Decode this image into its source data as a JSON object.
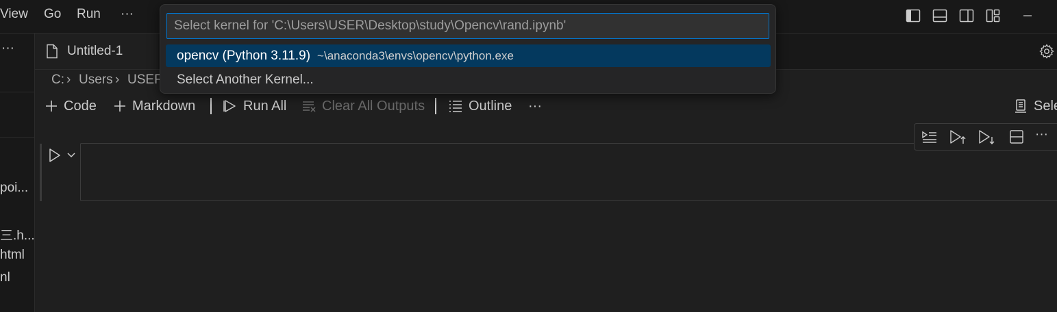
{
  "menu": [
    "View",
    "Go",
    "Run",
    "···"
  ],
  "tab": {
    "label": "Untitled-1"
  },
  "breadcrumb": [
    "C:",
    "Users",
    "USER"
  ],
  "sidebar": {
    "texts": [
      "poi...",
      "三.h...",
      "html",
      "nl"
    ]
  },
  "toolbar": {
    "code": "Code",
    "markdown": "Markdown",
    "run_all": "Run All",
    "clear_all": "Clear All Outputs",
    "outline": "Outline",
    "more": "···",
    "kernel": "Sele"
  },
  "quickpick": {
    "placeholder": "Select kernel for 'C:\\Users\\USER\\Desktop\\study\\Opencv\\rand.ipynb'",
    "items": [
      {
        "label": "opencv (Python 3.11.9)",
        "detail": "~\\anaconda3\\envs\\opencv\\python.exe"
      },
      {
        "label": "Select Another Kernel..."
      }
    ]
  },
  "colors": {
    "accent": "#0078d4",
    "selected_bg": "#04395e",
    "background": "#1f1f1f"
  }
}
